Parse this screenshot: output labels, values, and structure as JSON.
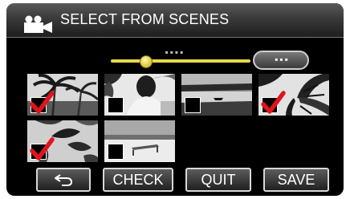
{
  "header": {
    "title": "SELECT FROM SCENES",
    "icon": "video-camera-icon"
  },
  "pager": {
    "indicator": "▪▪▪▪",
    "slider_value": 0.25,
    "slider_button_label": "▪▪▪"
  },
  "thumbnails": [
    {
      "scene": "palm-trees",
      "checked": true
    },
    {
      "scene": "person-outdoors",
      "checked": false
    },
    {
      "scene": "lakeside-shore",
      "checked": false
    },
    {
      "scene": "palm-fronds",
      "checked": true
    },
    {
      "scene": "leaves-closeup",
      "checked": true
    },
    {
      "scene": "beach-bench",
      "checked": false
    }
  ],
  "buttons": {
    "back_icon": "return-arrow-icon",
    "check_label": "CHECK",
    "quit_label": "QUIT",
    "save_label": "SAVE"
  },
  "colors": {
    "checkmark": "#e0141c",
    "slider": "#e9d84a"
  }
}
